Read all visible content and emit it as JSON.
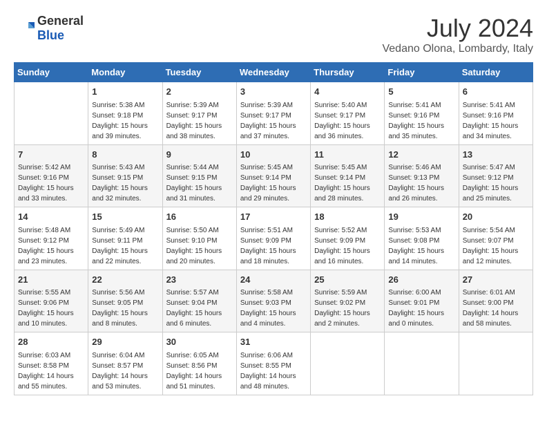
{
  "header": {
    "logo_general": "General",
    "logo_blue": "Blue",
    "month_year": "July 2024",
    "location": "Vedano Olona, Lombardy, Italy"
  },
  "calendar": {
    "columns": [
      "Sunday",
      "Monday",
      "Tuesday",
      "Wednesday",
      "Thursday",
      "Friday",
      "Saturday"
    ],
    "weeks": [
      [
        {
          "day": "",
          "info": ""
        },
        {
          "day": "1",
          "info": "Sunrise: 5:38 AM\nSunset: 9:18 PM\nDaylight: 15 hours\nand 39 minutes."
        },
        {
          "day": "2",
          "info": "Sunrise: 5:39 AM\nSunset: 9:17 PM\nDaylight: 15 hours\nand 38 minutes."
        },
        {
          "day": "3",
          "info": "Sunrise: 5:39 AM\nSunset: 9:17 PM\nDaylight: 15 hours\nand 37 minutes."
        },
        {
          "day": "4",
          "info": "Sunrise: 5:40 AM\nSunset: 9:17 PM\nDaylight: 15 hours\nand 36 minutes."
        },
        {
          "day": "5",
          "info": "Sunrise: 5:41 AM\nSunset: 9:16 PM\nDaylight: 15 hours\nand 35 minutes."
        },
        {
          "day": "6",
          "info": "Sunrise: 5:41 AM\nSunset: 9:16 PM\nDaylight: 15 hours\nand 34 minutes."
        }
      ],
      [
        {
          "day": "7",
          "info": "Sunrise: 5:42 AM\nSunset: 9:16 PM\nDaylight: 15 hours\nand 33 minutes."
        },
        {
          "day": "8",
          "info": "Sunrise: 5:43 AM\nSunset: 9:15 PM\nDaylight: 15 hours\nand 32 minutes."
        },
        {
          "day": "9",
          "info": "Sunrise: 5:44 AM\nSunset: 9:15 PM\nDaylight: 15 hours\nand 31 minutes."
        },
        {
          "day": "10",
          "info": "Sunrise: 5:45 AM\nSunset: 9:14 PM\nDaylight: 15 hours\nand 29 minutes."
        },
        {
          "day": "11",
          "info": "Sunrise: 5:45 AM\nSunset: 9:14 PM\nDaylight: 15 hours\nand 28 minutes."
        },
        {
          "day": "12",
          "info": "Sunrise: 5:46 AM\nSunset: 9:13 PM\nDaylight: 15 hours\nand 26 minutes."
        },
        {
          "day": "13",
          "info": "Sunrise: 5:47 AM\nSunset: 9:12 PM\nDaylight: 15 hours\nand 25 minutes."
        }
      ],
      [
        {
          "day": "14",
          "info": "Sunrise: 5:48 AM\nSunset: 9:12 PM\nDaylight: 15 hours\nand 23 minutes."
        },
        {
          "day": "15",
          "info": "Sunrise: 5:49 AM\nSunset: 9:11 PM\nDaylight: 15 hours\nand 22 minutes."
        },
        {
          "day": "16",
          "info": "Sunrise: 5:50 AM\nSunset: 9:10 PM\nDaylight: 15 hours\nand 20 minutes."
        },
        {
          "day": "17",
          "info": "Sunrise: 5:51 AM\nSunset: 9:09 PM\nDaylight: 15 hours\nand 18 minutes."
        },
        {
          "day": "18",
          "info": "Sunrise: 5:52 AM\nSunset: 9:09 PM\nDaylight: 15 hours\nand 16 minutes."
        },
        {
          "day": "19",
          "info": "Sunrise: 5:53 AM\nSunset: 9:08 PM\nDaylight: 15 hours\nand 14 minutes."
        },
        {
          "day": "20",
          "info": "Sunrise: 5:54 AM\nSunset: 9:07 PM\nDaylight: 15 hours\nand 12 minutes."
        }
      ],
      [
        {
          "day": "21",
          "info": "Sunrise: 5:55 AM\nSunset: 9:06 PM\nDaylight: 15 hours\nand 10 minutes."
        },
        {
          "day": "22",
          "info": "Sunrise: 5:56 AM\nSunset: 9:05 PM\nDaylight: 15 hours\nand 8 minutes."
        },
        {
          "day": "23",
          "info": "Sunrise: 5:57 AM\nSunset: 9:04 PM\nDaylight: 15 hours\nand 6 minutes."
        },
        {
          "day": "24",
          "info": "Sunrise: 5:58 AM\nSunset: 9:03 PM\nDaylight: 15 hours\nand 4 minutes."
        },
        {
          "day": "25",
          "info": "Sunrise: 5:59 AM\nSunset: 9:02 PM\nDaylight: 15 hours\nand 2 minutes."
        },
        {
          "day": "26",
          "info": "Sunrise: 6:00 AM\nSunset: 9:01 PM\nDaylight: 15 hours\nand 0 minutes."
        },
        {
          "day": "27",
          "info": "Sunrise: 6:01 AM\nSunset: 9:00 PM\nDaylight: 14 hours\nand 58 minutes."
        }
      ],
      [
        {
          "day": "28",
          "info": "Sunrise: 6:03 AM\nSunset: 8:58 PM\nDaylight: 14 hours\nand 55 minutes."
        },
        {
          "day": "29",
          "info": "Sunrise: 6:04 AM\nSunset: 8:57 PM\nDaylight: 14 hours\nand 53 minutes."
        },
        {
          "day": "30",
          "info": "Sunrise: 6:05 AM\nSunset: 8:56 PM\nDaylight: 14 hours\nand 51 minutes."
        },
        {
          "day": "31",
          "info": "Sunrise: 6:06 AM\nSunset: 8:55 PM\nDaylight: 14 hours\nand 48 minutes."
        },
        {
          "day": "",
          "info": ""
        },
        {
          "day": "",
          "info": ""
        },
        {
          "day": "",
          "info": ""
        }
      ]
    ]
  }
}
